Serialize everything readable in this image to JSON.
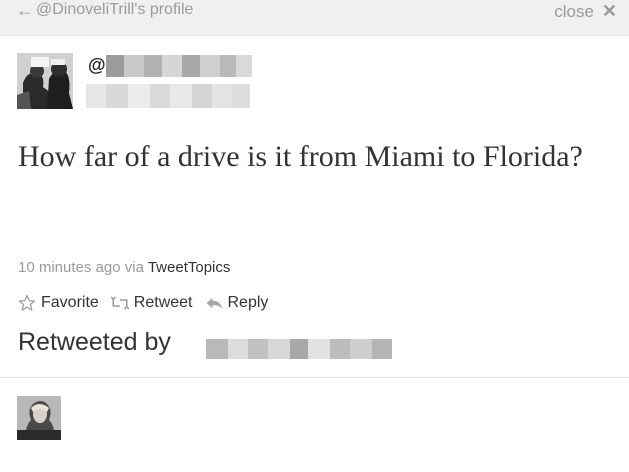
{
  "header": {
    "back_label": "@DinoveliTrill's profile",
    "close_label": "close",
    "back_icon": "left-arrow-icon",
    "close_icon": "x-icon"
  },
  "tweet": {
    "handle_prefix": "@",
    "text": "How far of a drive is it from Miami to Florida?",
    "time": "10 minutes ago",
    "via_label": "via",
    "via_app": "TweetTopics"
  },
  "actions": [
    {
      "label": "Favorite",
      "icon": "star-icon"
    },
    {
      "label": "Retweet",
      "icon": "retweet-icon"
    },
    {
      "label": "Reply",
      "icon": "reply-icon"
    }
  ],
  "retweeted_by_label": "Retweeted by",
  "colors": {
    "muted": "#9a9a9a",
    "text": "#333333",
    "header_bg": "#f0f0f0"
  }
}
